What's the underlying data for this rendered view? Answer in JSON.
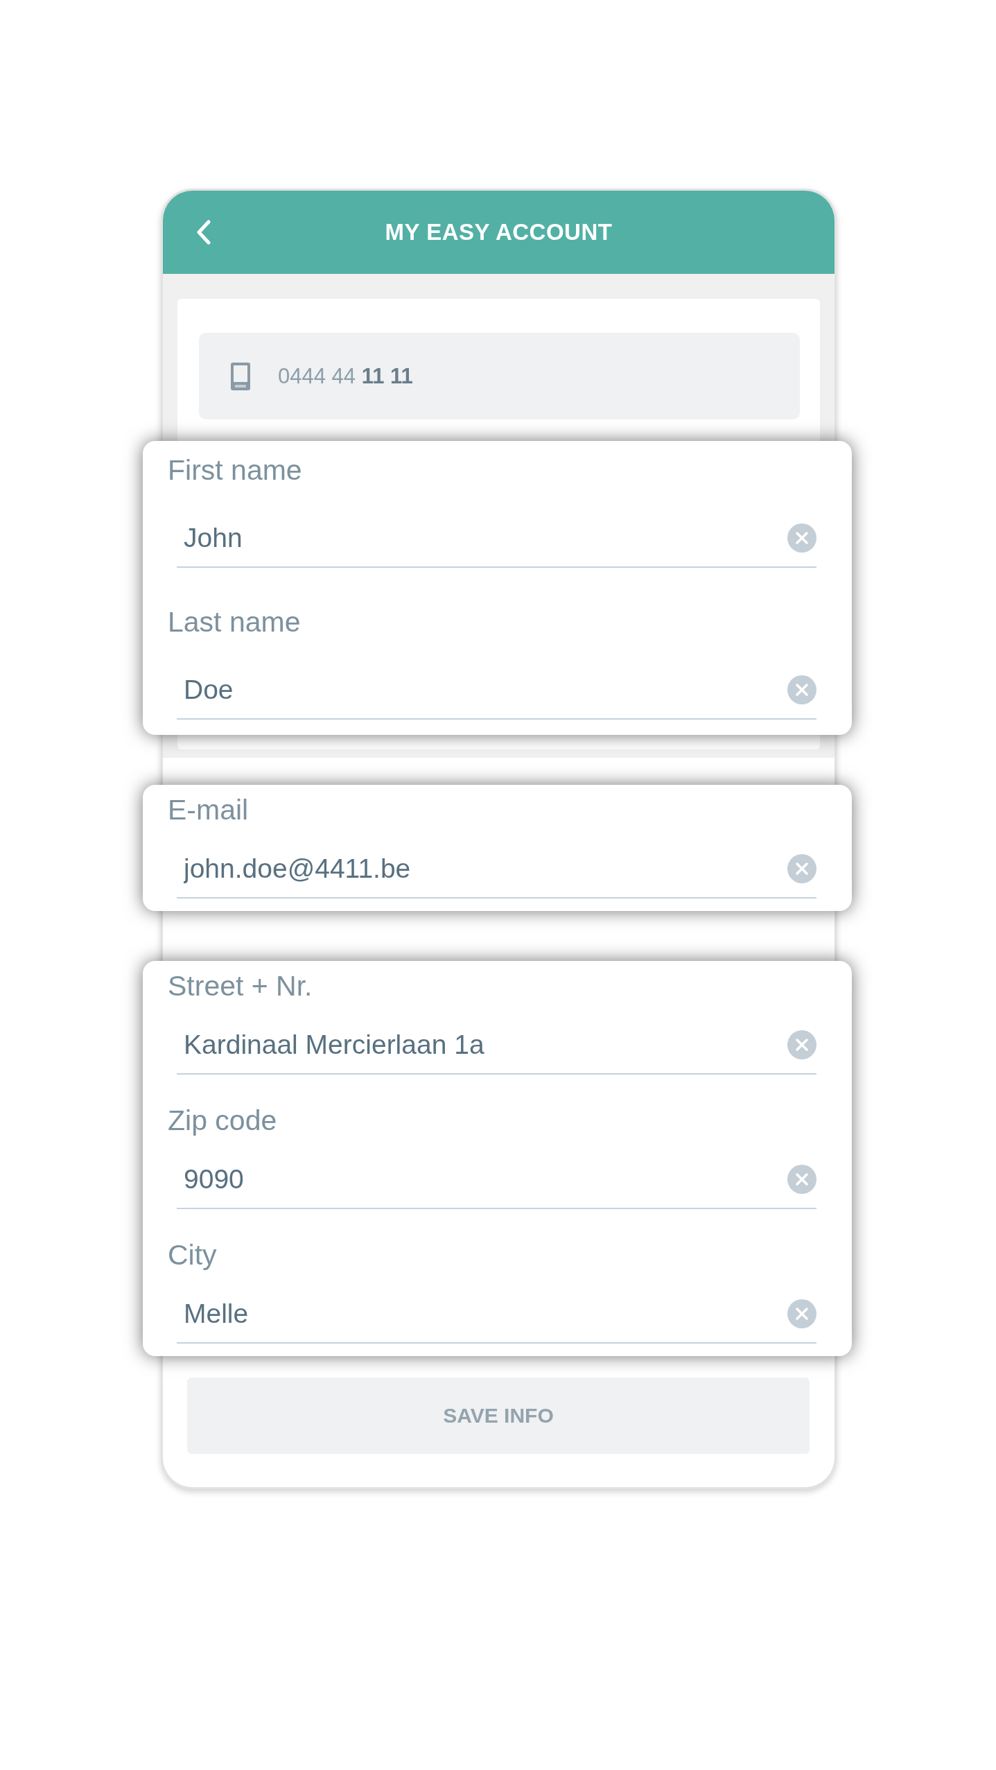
{
  "background_screen": {
    "header": {
      "title": "MY EASY ACCOUNT"
    },
    "phone_field": {
      "value": "0444 44 **11 11**"
    },
    "save_button": {
      "label": "SAVE INFO",
      "disabled": true
    }
  },
  "cards": [
    {
      "fields": [
        {
          "label": "First name",
          "value": "John"
        },
        {
          "label": "Last name",
          "value": "Doe"
        }
      ]
    },
    {
      "fields": [
        {
          "label": "E-mail",
          "value": "john.doe@4411.be"
        }
      ]
    },
    {
      "fields": [
        {
          "label": "Street + Nr.",
          "value": "Kardinaal Mercierlaan 1a"
        },
        {
          "label": "Zip code",
          "value": "9090"
        },
        {
          "label": "City",
          "value": "Melle"
        }
      ]
    }
  ]
}
